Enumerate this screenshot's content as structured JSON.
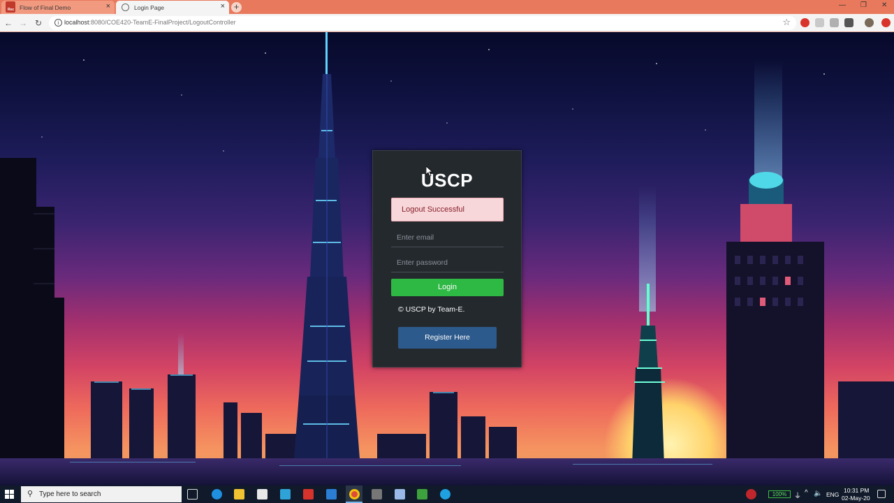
{
  "browser": {
    "tabs": [
      {
        "label": "Flow of Final Demo",
        "active": false
      },
      {
        "label": "Login Page",
        "active": true
      }
    ],
    "recording_badge": "Rec",
    "url_host": "localhost",
    "url_path": ":8080/COE420-TeamE-FinalProject/LogoutController",
    "icons": [
      "back-icon",
      "forward-icon",
      "reload-icon",
      "info-icon",
      "star-icon",
      "new-tab-icon"
    ]
  },
  "login": {
    "title": "USCP",
    "alert": "Logout Successful",
    "email_placeholder": "Enter email",
    "password_placeholder": "Enter password",
    "login_label": "Login",
    "copyright": "© USCP by Team-E.",
    "register_label": "Register Here",
    "colors": {
      "card": "#24292e",
      "alert_bg": "#f8d7da",
      "login": "#2eb844",
      "register": "#2d5a8c"
    }
  },
  "taskbar": {
    "search_placeholder": "Type here to search",
    "battery": "100%",
    "language": "ENG",
    "time": "10:31 PM",
    "date": "02-May-20"
  }
}
